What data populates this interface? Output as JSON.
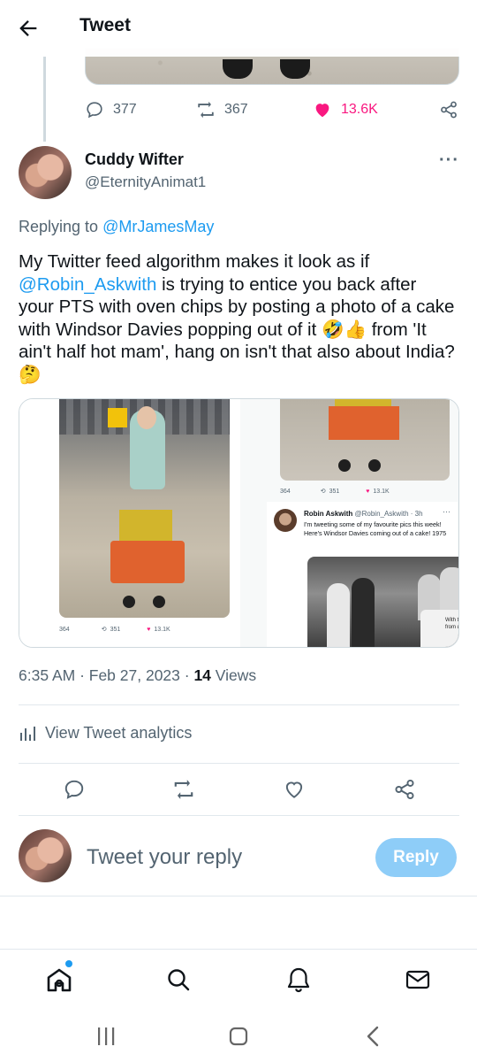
{
  "header": {
    "title": "Tweet"
  },
  "prev_tweet": {
    "replies": "377",
    "retweets": "367",
    "likes": "13.6K"
  },
  "reply_tweet": {
    "author_name": "Cuddy Wifter",
    "author_handle": "@EternityAnimat1",
    "more": "···",
    "replying_prefix": "Replying to ",
    "replying_to": "@MrJamesMay",
    "text_1": "My Twitter feed algorithm makes it look as if ",
    "mention": "@Robin_Askwith",
    "text_2": " is trying to entice you back after your PTS with oven chips by posting a photo of a cake with Windsor Davies popping out of it 🤣👍 from 'It ain't half hot mam', hang on isn't that also about India? 🤔",
    "timestamp": "6:35 AM · Feb 27, 2023 · ",
    "views_count": "14",
    "views_label": " Views",
    "analytics_label": "View Tweet analytics"
  },
  "media": {
    "left_stats": {
      "replies": "364",
      "retweets": "351",
      "likes": "13.1K"
    },
    "right_stats": {
      "replies": "364",
      "retweets": "351",
      "likes": "13.1K"
    },
    "embedded_tweet": {
      "name": "Robin Askwith",
      "handle_time": " @Robin_Askwith · 3h",
      "more": "···",
      "text": "I'm tweeting some of my favourite pics this week! Here's Windsor Davies coming out of a cake! 1975",
      "cake_caption": "With too from da 10"
    }
  },
  "composer": {
    "placeholder": "Tweet your reply",
    "reply_button": "Reply"
  },
  "colors": {
    "accent": "#1d9bf0",
    "like": "#f91880",
    "reply_button_disabled": "#8ecdf8",
    "secondary_text": "#536471"
  },
  "icons": {
    "back": "arrow-left-icon",
    "reply": "comment-icon",
    "retweet": "retweet-icon",
    "like": "heart-icon",
    "share": "share-icon",
    "analytics": "bar-chart-icon",
    "nav_home": "home-icon",
    "nav_search": "search-icon",
    "nav_notifications": "bell-icon",
    "nav_messages": "mail-icon"
  }
}
